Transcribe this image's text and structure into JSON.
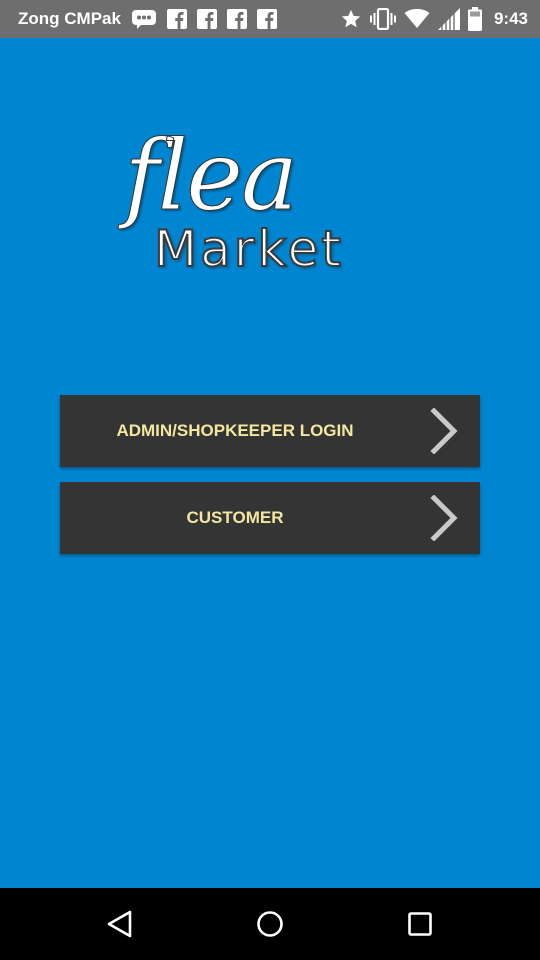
{
  "status_bar": {
    "carrier": "Zong CMPak",
    "time": "9:43",
    "icons": [
      "messaging-icon",
      "facebook-icon",
      "facebook-icon",
      "facebook-icon",
      "facebook-icon",
      "star-icon",
      "vibrate-icon",
      "wifi-icon",
      "signal-icon",
      "battery-icon"
    ]
  },
  "logo": {
    "script_text": "flea",
    "word_text": "Market"
  },
  "buttons": [
    {
      "label": "ADMIN/SHOPKEEPER LOGIN",
      "icon": "chevron-right-icon"
    },
    {
      "label": "CUSTOMER",
      "icon": "chevron-right-icon"
    }
  ],
  "nav_bar": {
    "icons": [
      "back-icon",
      "home-icon",
      "recents-icon"
    ]
  },
  "colors": {
    "background": "#0086D1",
    "status_bar": "#6E6E6E",
    "button_bg": "#343434",
    "button_text": "#F3E7A0",
    "nav_bar": "#000000"
  }
}
